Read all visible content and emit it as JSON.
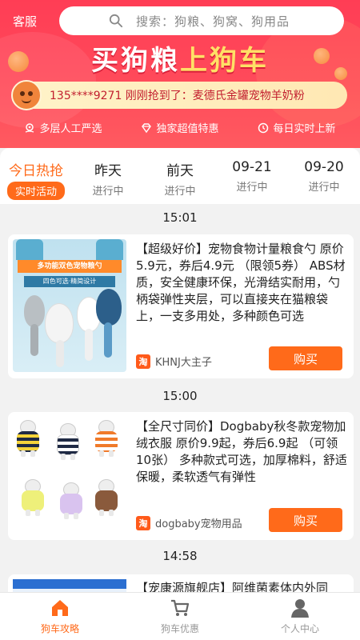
{
  "header": {
    "service_label": "客服",
    "search_placeholder": "搜索：狗粮、狗窝、狗用品",
    "banner_white": "买狗粮",
    "banner_yellow": "上狗车",
    "ticker_text": "135****9271 刚刚抢到了：麦德氏金罐宠物羊奶粉",
    "features": [
      "多层人工严选",
      "独家超值特惠",
      "每日实时上新"
    ]
  },
  "tabs": [
    {
      "title": "今日热抢",
      "sub": "实时活动",
      "active": true
    },
    {
      "title": "昨天",
      "sub": "进行中",
      "active": false
    },
    {
      "title": "前天",
      "sub": "进行中",
      "active": false
    },
    {
      "title": "09-21",
      "sub": "进行中",
      "active": false
    },
    {
      "title": "09-20",
      "sub": "进行中",
      "active": false
    }
  ],
  "items": [
    {
      "time": "15:01",
      "desc": "【超级好价】宠物食物计量粮食勺 原价5.9元，券后4.9元 （限领5券） ABS材质，安全健康环保，光滑结实耐用，勺柄袋弹性夹层，可以直接夹在猫粮袋上，一支多用处，多种颜色可选",
      "shop": "KHNJ大主子",
      "buy_label": "购买",
      "thumb_text_1": "多功能双色宠物粮勺",
      "thumb_text_2": "四色可选·精简设计"
    },
    {
      "time": "15:00",
      "desc": "【全尺寸同价】Dogbaby秋冬款宠物加绒衣服 原价9.9起，券后6.9起 （可领10张） 多种款式可选，加厚棉料，舒适保暖，柔软透气有弹性",
      "shop": "dogbaby宠物用品",
      "buy_label": "购买"
    },
    {
      "time": "14:58",
      "desc_partial": "【宠康源旗舰店】阿维菌素体内外同"
    }
  ],
  "shop_badge": "淘",
  "bottom_nav": [
    {
      "label": "狗车攻略",
      "icon": "home-icon",
      "active": true
    },
    {
      "label": "狗车优惠",
      "icon": "cart-icon",
      "active": false
    },
    {
      "label": "个人中心",
      "icon": "person-icon",
      "active": false
    }
  ],
  "colors": {
    "accent": "#ff6a1a",
    "header": "#ff3d55",
    "ticker_text": "#c21f2f"
  }
}
